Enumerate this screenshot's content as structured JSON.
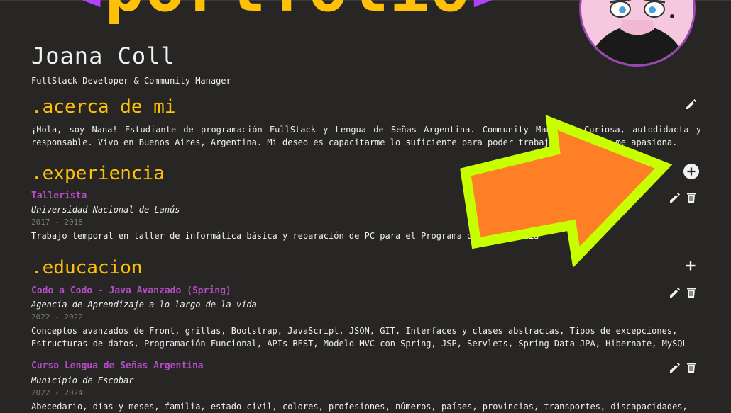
{
  "header": {
    "banner_open": "<",
    "banner_text": "portfolio",
    "banner_close": ">",
    "name": "Joana Coll",
    "subtitle": "FullStack Developer & Community Manager"
  },
  "about": {
    "title": ".acerca de mi",
    "text": "¡Hola, soy Nana! Estudiante de programación FullStack y Lengua de Señas Argentina. Community Manager. Curiosa, autodidacta y responsable. Vivo en Buenos Aires, Argentina. Mi deseo es capacitarme lo suficiente para poder trabajar en lo que me apasiona."
  },
  "experience": {
    "title": ".experiencia",
    "items": [
      {
        "role": "Tallerista",
        "org": "Universidad Nacional de Lanús",
        "dates": "2017 - 2018",
        "desc": "Trabajo temporal en taller de informática básica y reparación de PC para el Programa de Verano UNLa"
      }
    ]
  },
  "education": {
    "title": ".educacion",
    "items": [
      {
        "role": "Codo a Codo - Java Avanzado (Spring)",
        "org": "Agencia de Aprendizaje a lo largo de la vida",
        "dates": "2022 - 2022",
        "desc": "Conceptos avanzados de Front, grillas, Bootstrap, JavaScript, JSON, GIT, Interfaces y clases abstractas, Tipos de excepciones, Estructuras de datos, Programación Funcional, APIs REST, Modelo MVC con Spring, JSP, Servlets, Spring Data JPA, Hibernate, MySQL"
      },
      {
        "role": "Curso Lengua de Señas Argentina",
        "org": "Municipio de Escobar",
        "dates": "2022 - 2024",
        "desc": "Abecedario, días y meses, familia, estado civil, colores, profesiones, números, países, provincias, transportes, discapacidades,"
      }
    ]
  },
  "icons": {
    "edit": "pencil-icon",
    "delete": "trash-icon",
    "add": "plus-icon",
    "add_circle": "plus-circle-icon",
    "annotation": "arrow-annotation"
  },
  "colors": {
    "background": "#272624",
    "accent": "#ffc107",
    "role": "#b24cc2",
    "arrow_fill": "#ff7f27",
    "arrow_border": "#c8ff00"
  }
}
